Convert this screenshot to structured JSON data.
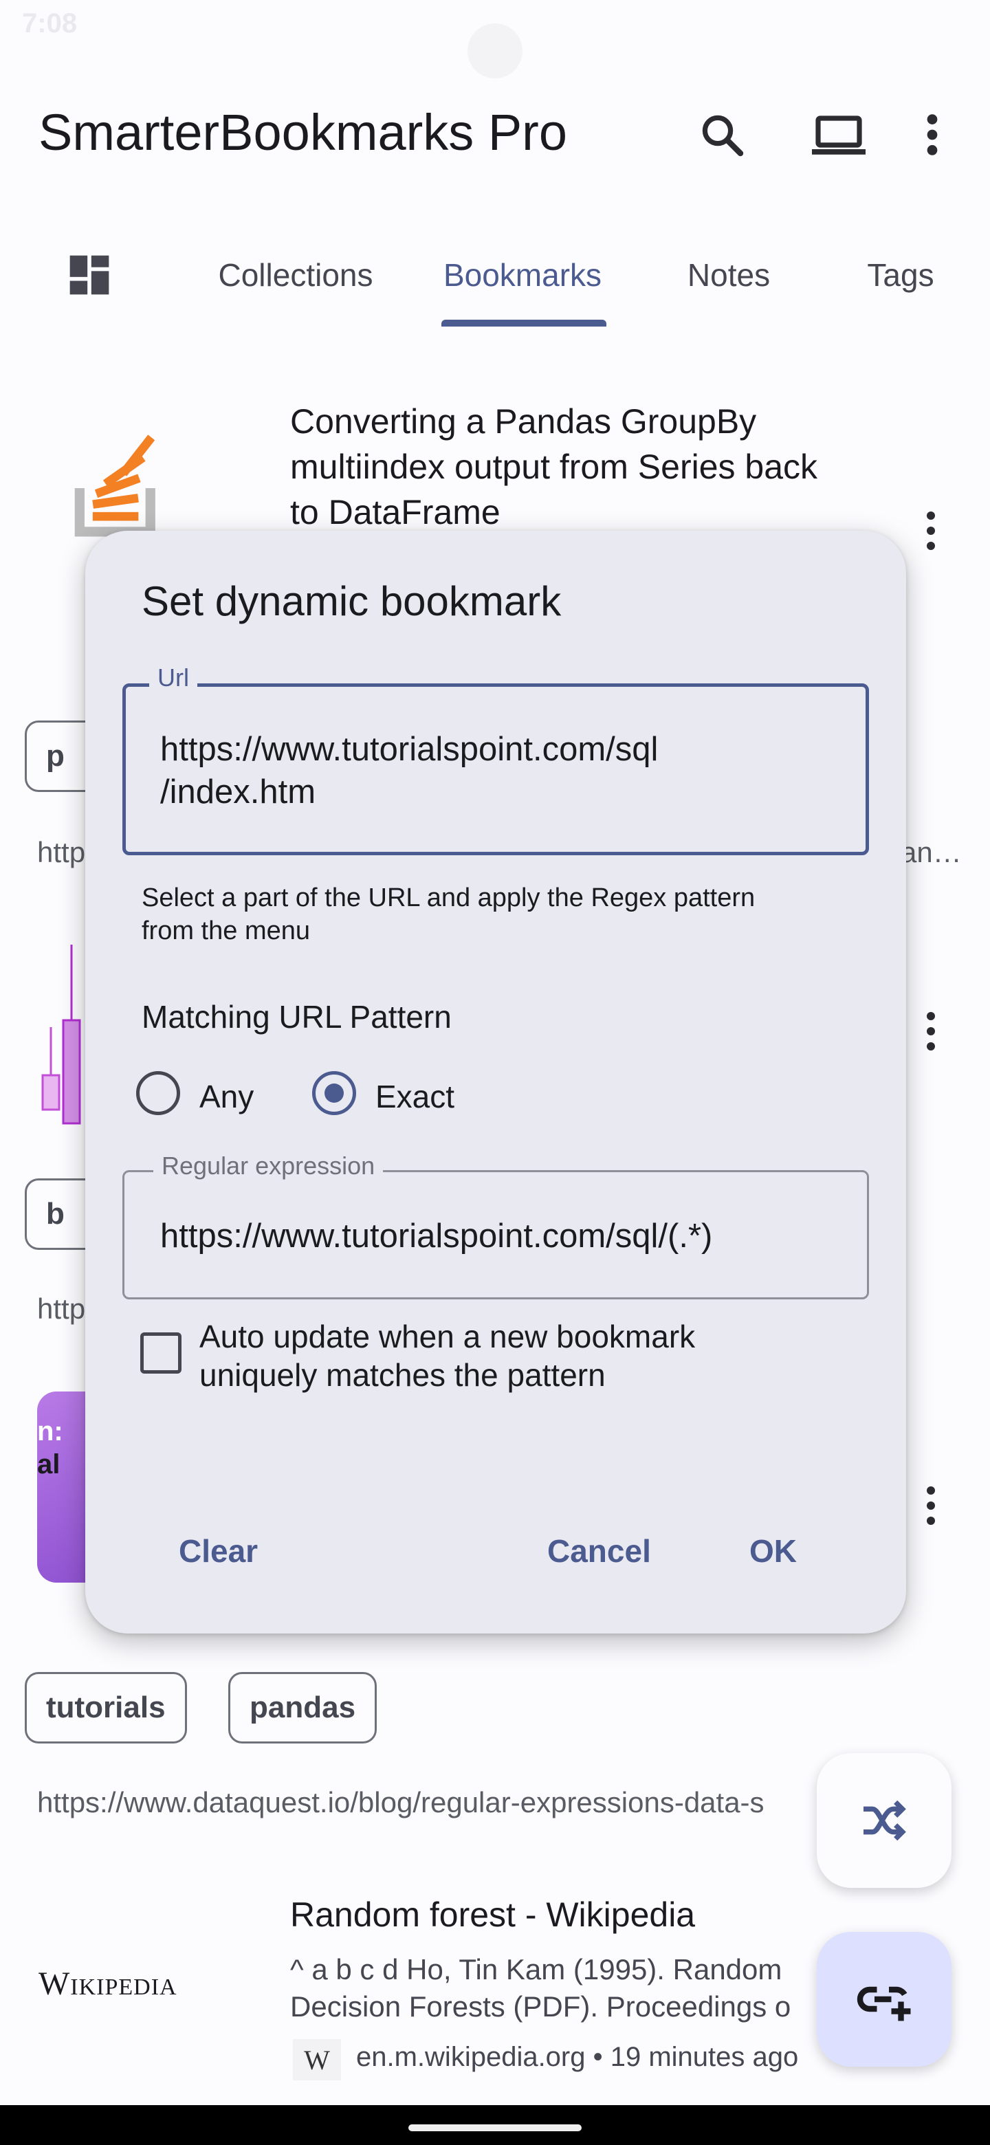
{
  "status_bar": {
    "time": "7:08"
  },
  "app_bar": {
    "title": "SmarterBookmarks Pro",
    "icons": [
      "search-icon",
      "laptop-icon",
      "more-vert-icon"
    ]
  },
  "tabs": [
    {
      "label": "Collections",
      "active": false
    },
    {
      "label": "Bookmarks",
      "active": true
    },
    {
      "label": "Notes",
      "active": false
    },
    {
      "label": "Tags",
      "active": false
    }
  ],
  "list": {
    "item1": {
      "title_line1": "Converting a Pandas GroupBy",
      "title_line2": "multiindex output from Series back",
      "title_line3": "to DataFrame"
    },
    "row2": {
      "chip": "p",
      "url": "http",
      "url_tail": "an…"
    },
    "row3": {
      "chip": "b",
      "url": "http"
    },
    "item4": {
      "thumb_line1": "n:",
      "thumb_line2": "al"
    },
    "tags": [
      "tutorials",
      "pandas"
    ],
    "url_dataquest": "https://www.dataquest.io/blog/regular-expressions-data-s",
    "item5": {
      "title": "Random forest - Wikipedia",
      "logo": "Wikipedia",
      "desc_line1": "^ a b c d Ho, Tin Kam (1995). Random",
      "desc_line2": "Decision Forests (PDF). Proceedings o",
      "favicon": "W",
      "source": "en.m.wikipedia.org • 19 minutes ago"
    }
  },
  "dialog": {
    "title": "Set dynamic bookmark",
    "url_field": {
      "label": "Url",
      "value_line1": "https://www.tutorialspoint.com/sql",
      "value_line2": "/index.htm"
    },
    "helper_line1": "Select a part of the URL and apply the Regex pattern",
    "helper_line2": "from the menu",
    "matching_label": "Matching URL Pattern",
    "radio_options": [
      {
        "label": "Any",
        "selected": false
      },
      {
        "label": "Exact",
        "selected": true
      }
    ],
    "regex_field": {
      "label": "Regular expression",
      "value": "https://www.tutorialspoint.com/sql/(.*)"
    },
    "auto_update": {
      "checked": false,
      "label_line1": "Auto update when a new bookmark",
      "label_line2": "uniquely matches the pattern"
    },
    "buttons": {
      "clear": "Clear",
      "cancel": "Cancel",
      "ok": "OK"
    }
  },
  "colors": {
    "primary": "#4b5a8f",
    "dialog_bg": "#e9e9f2",
    "fab_container": "#dde1ff",
    "stackoverflow_orange": "#f48024"
  }
}
